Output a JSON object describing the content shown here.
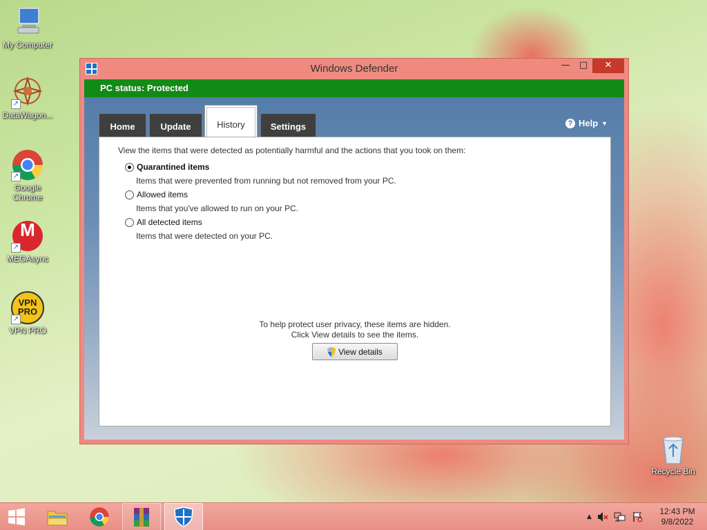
{
  "desktop": {
    "icons": [
      {
        "label": "My Computer",
        "icon": "computer-icon"
      },
      {
        "label": "DataWagon...",
        "icon": "datawagon-icon"
      },
      {
        "label": "Google Chrome",
        "icon": "chrome-icon"
      },
      {
        "label": "MEGAsync",
        "icon": "mega-icon"
      },
      {
        "label": "VPN PRO",
        "icon": "vpn-pro-icon"
      },
      {
        "label": "Recycle Bin",
        "icon": "recycle-bin-icon"
      }
    ],
    "vpn_badge_text": "VPN\nPRO",
    "mega_glyph": "M"
  },
  "window": {
    "title": "Windows Defender",
    "controls": {
      "minimize": "—",
      "maximize": "□",
      "close": "✕"
    },
    "status": "PC status: Protected",
    "status_color": "#138a15",
    "tabs": [
      {
        "label": "Home",
        "active": false
      },
      {
        "label": "Update",
        "active": false
      },
      {
        "label": "History",
        "active": true
      },
      {
        "label": "Settings",
        "active": false
      }
    ],
    "help": {
      "label": "Help",
      "icon_glyph": "?",
      "caret": "▼"
    },
    "history": {
      "intro": "View the items that were detected as potentially harmful and the actions that you took on them:",
      "options": [
        {
          "label": "Quarantined items",
          "description": "Items that were prevented from running but not removed from your PC.",
          "checked": true
        },
        {
          "label": "Allowed items",
          "description": "Items that you've allowed to run on your PC.",
          "checked": false
        },
        {
          "label": "All detected items",
          "description": "Items that were detected on your PC.",
          "checked": false
        }
      ],
      "privacy_line1": "To help protect user privacy, these items are hidden.",
      "privacy_line2": "Click View details to see the items.",
      "view_details_label": "View details"
    }
  },
  "taskbar": {
    "items": [
      "start-icon",
      "file-explorer-icon",
      "chrome-icon",
      "winrar-icon",
      "windows-defender-icon"
    ],
    "tray": {
      "overflow": "▲"
    },
    "clock_time": "12:43 PM",
    "clock_date": "9/8/2022"
  }
}
